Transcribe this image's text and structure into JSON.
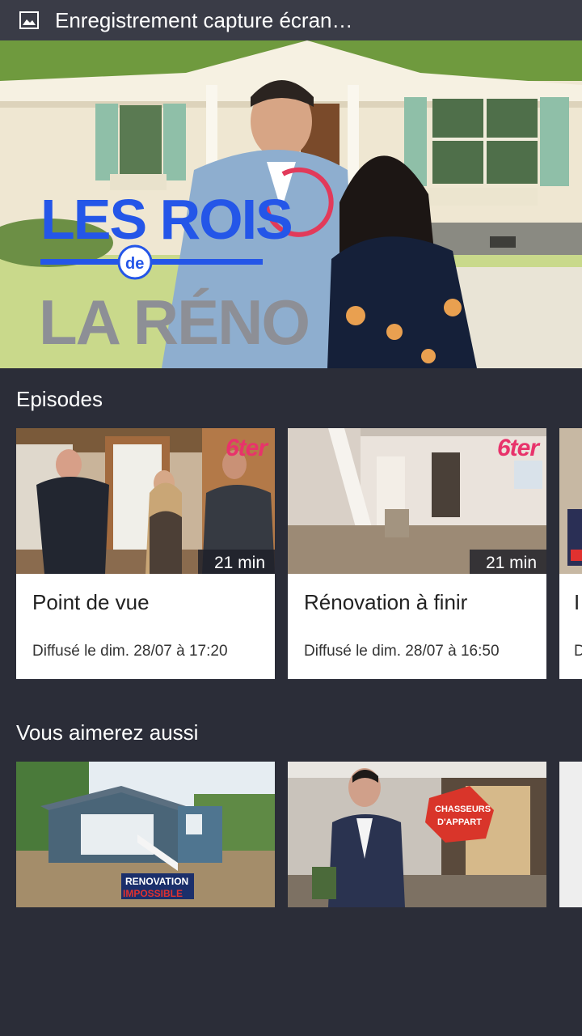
{
  "status_bar": {
    "notification_text": "Enregistrement capture écran…",
    "icon": "image-icon"
  },
  "hero": {
    "show_logo": {
      "line1": "LES ROIS",
      "connector": "de",
      "line2": "LA RÉNO"
    }
  },
  "episodes": {
    "heading": "Episodes",
    "items": [
      {
        "title": "Point de vue",
        "duration": "21 min",
        "aired": "Diffusé le dim. 28/07 à 17:20",
        "channel": "6ter"
      },
      {
        "title": "Rénovation à finir",
        "duration": "21 min",
        "aired": "Diffusé le dim. 28/07 à 16:50",
        "channel": "6ter"
      },
      {
        "title": "I",
        "duration": "",
        "aired": "D",
        "channel": ""
      }
    ]
  },
  "recommendations": {
    "heading": "Vous aimerez aussi",
    "items": [
      {
        "logo_line1": "RENOVATION",
        "logo_line2": "IMPOSSIBLE"
      },
      {
        "logo_line1": "CHASSEURS",
        "logo_line2": "D'APPART"
      }
    ]
  },
  "colors": {
    "background": "#2b2d38",
    "status_bar": "#3a3c47",
    "channel_accent": "#e8336b",
    "logo_blue": "#1f5fe0"
  }
}
